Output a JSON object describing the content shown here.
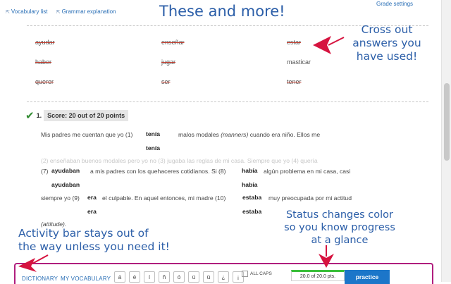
{
  "top_links": [
    {
      "icon": "external-link-icon",
      "label": "Vocabulary list"
    },
    {
      "icon": "external-link-icon",
      "label": "Grammar explanation"
    }
  ],
  "grade_settings": "Grade settings",
  "annotations": {
    "title": "These and more!",
    "cross_out": [
      "Cross out",
      "answers you",
      "have used!"
    ],
    "status": [
      "Status changes color",
      "so you know progress",
      "at a glance"
    ],
    "activity": [
      "Activity bar stays out of",
      "the way unless you need it!"
    ],
    "arrow_color": "#d6133f"
  },
  "word_bank": [
    {
      "word": "ayudar",
      "used": true
    },
    {
      "word": "enseñar",
      "used": true
    },
    {
      "word": "estar",
      "used": true
    },
    {
      "word": "haber",
      "used": true
    },
    {
      "word": "jugar",
      "used": true
    },
    {
      "word": "masticar",
      "used": false
    },
    {
      "word": "querer",
      "used": true
    },
    {
      "word": "ser",
      "used": true
    },
    {
      "word": "tener",
      "used": true
    }
  ],
  "question": {
    "number": "1.",
    "score": "Score: 20 out of 20 points",
    "line1_a": "Mis padres me cuentan que yo (1)",
    "line1_b": "malos modales",
    "line1_c": "(manners)",
    "line1_d": "cuando era niño. Ellos me",
    "answers": [
      "tenía",
      "tenía",
      "ayudaban",
      "había",
      "ayudaban",
      "había",
      "era",
      "estaba",
      "era",
      "estaba"
    ],
    "faded_line": "(2)   enseñaban   buenos modales pero yo no (3)   jugaba   las reglas de mi casa. Siempre que yo (4)   quería",
    "line3_a": "(7)",
    "line3_b": "a mis padres con los quehaceres cotidianos. Si (8)",
    "line3_c": "algún problema en mi casa, casi",
    "line4_a": "siempre yo (9)",
    "line4_b": "el culpable. En aquel entonces, mi madre (10)",
    "line4_c": "muy preocupada por mi actitud",
    "line5": "(attitude)."
  },
  "activity_bar": {
    "border_color": "#b01e7e",
    "dictionary": "DICTIONARY",
    "my_vocabulary": "MY VOCABULARY",
    "keys": [
      "á",
      "é",
      "í",
      "ñ",
      "ó",
      "ú",
      "ü",
      "¿",
      "¡"
    ],
    "all_caps": "ALL CAPS",
    "status": "20.0 of 20.0 pts.",
    "status_color": "#3bbf3b",
    "practice": "practice"
  }
}
